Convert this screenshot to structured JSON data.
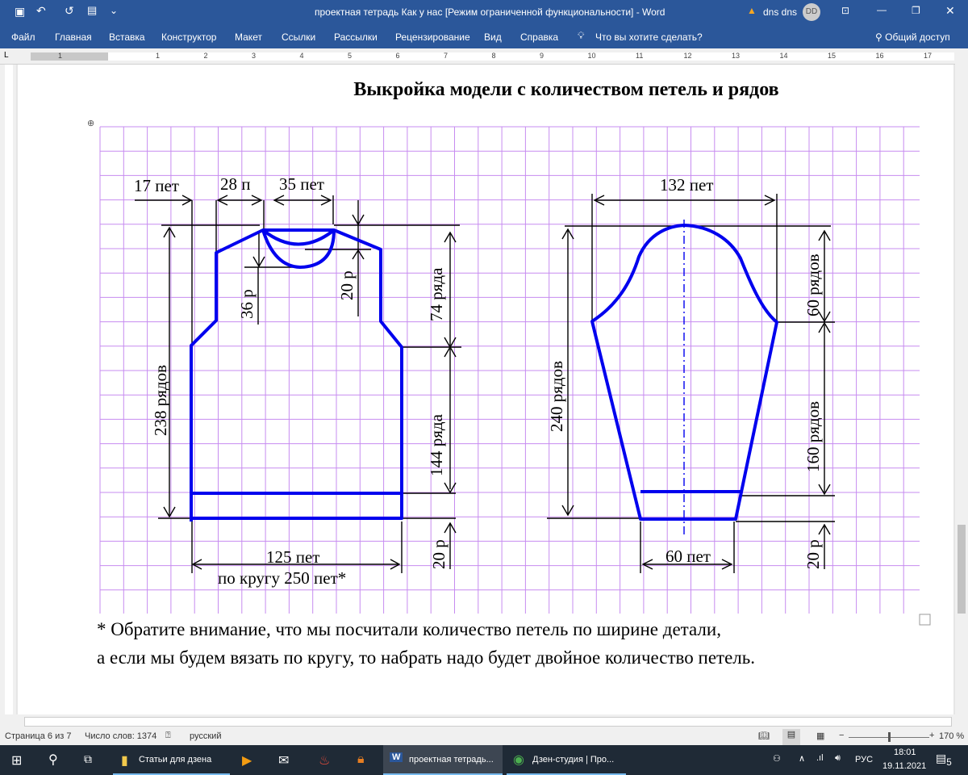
{
  "window": {
    "title": "проектная тетрадь  Как у нас [Режим ограниченной функциональности]  -  Word",
    "user": "dns dns",
    "avatar": "DD"
  },
  "ribbon": {
    "tabs": [
      "Файл",
      "Главная",
      "Вставка",
      "Конструктор",
      "Макет",
      "Ссылки",
      "Рассылки",
      "Рецензирование",
      "Вид",
      "Справка"
    ],
    "search": "Что вы хотите сделать?",
    "share": "Общий доступ"
  },
  "ruler": {
    "numbers": [
      "1",
      "1",
      "2",
      "3",
      "4",
      "5",
      "6",
      "7",
      "8",
      "9",
      "10",
      "11",
      "12",
      "13",
      "14",
      "15",
      "16",
      "17"
    ]
  },
  "document": {
    "title": "Выкройка модели с количеством петель и рядов",
    "labels": {
      "l17": "17 пет",
      "l28": "28 п",
      "l35": "35 пет",
      "l36": "36 р",
      "l20a": "20 р",
      "l74": "74 ряда",
      "l238": "238 рядов",
      "l144": "144 ряда",
      "l20b": "20 р",
      "l125": "125 пет",
      "lround": "по кругу 250 пет*",
      "l132": "132 пет",
      "l60r": "60 рядов",
      "l240": "240 рядов",
      "l160": "160 рядов",
      "l60p": "60 пет",
      "l20c": "20 р"
    },
    "note1": "* Обратите внимание, что мы посчитали количество петель по ширине детали,",
    "note2": "а если мы будем вязать по кругу, то набрать надо будет двойное количество петель."
  },
  "colors": {
    "grid": "#c78cf0",
    "outline": "#0000ee",
    "titlebar": "#2b579a"
  },
  "status": {
    "page": "Страница 6 из 7",
    "words": "Число слов: 1374",
    "lang": "русский",
    "zoom": "170 %",
    "zoom_percent": 170
  },
  "taskbar": {
    "items": [
      "Статьи для дзена",
      "проектная тетрадь...",
      "Дзен-студия | Про..."
    ],
    "lang": "РУС",
    "time": "18:01",
    "date": "19.11.2021",
    "notifications": "5"
  }
}
